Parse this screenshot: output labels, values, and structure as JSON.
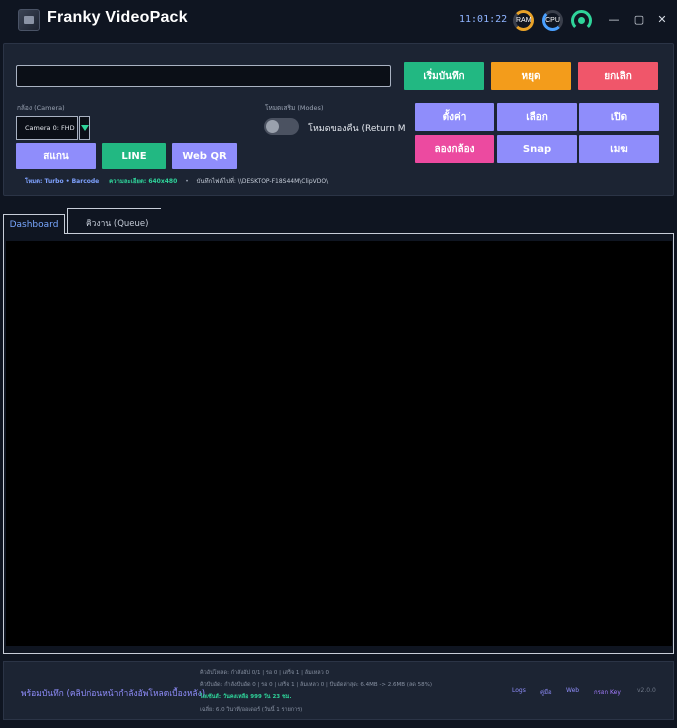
{
  "titlebar": {
    "title": "Franky VideoPack",
    "clock": "11:01:22",
    "ram_label": "RAM",
    "cpu_label": "CPU",
    "minimize": "—",
    "maximize": "▢",
    "close": "✕"
  },
  "controls": {
    "url_value": "",
    "record_label": "เริ่มบันทึก",
    "stop_label": "หยุด",
    "cancel_label": "ยกเลิก",
    "camera_label": "กล้อง (Camera)",
    "camera_value": "Camera 0: FHD",
    "modes_label": "โหมดเสริม (Modes)",
    "return_mode_label": "โหมดของคืน (Return Moc",
    "scan_label": "สแกน",
    "line_label": "LINE",
    "webqr_label": "Web QR",
    "settings_label": "ตั้งค่า",
    "select_label": "เลือก",
    "open_label": "เปิด",
    "testcam_label": "ลองกล้อง",
    "snap_label": "Snap",
    "ms_label": "เมฆ",
    "status_mode": "โหมด: Turbo • Barcode",
    "status_resolution": "ความละเอียด: 640x480",
    "status_separator": "•",
    "status_save": "บันทึกไฟล์ไปที่: \\\\DESKTOP-F18S44M\\ClipVDO\\"
  },
  "tabs": [
    {
      "label": "Dashboard",
      "active": true
    },
    {
      "label": "คิวงาน (Queue)",
      "active": false
    }
  ],
  "footer": {
    "ready": "พร้อมบันทึก (คลิปก่อนหน้ากำลังอัพโหลดเบื้องหลัง)",
    "line1": "คิวอัปโหลด: กำลังอัป 0/1 | รอ 0 | เสร็จ 1 | ล้มเหลว 0",
    "line2": "คิวบีบอัด: กำลังบีบอัด 0 | รอ 0 | เสร็จ 1 | ล้มเหลว 0 | บีบอัดล่าสุด: 6.4MB -> 2.6MB (ลด 58%)",
    "line3": "ไลเซ้นส์: วันคงเหลือ 999 วัน 23 ชม.",
    "line4": "เฉลี่ย: 6.0 วินาที/ออเดอร์ (วันนี้ 1 รายการ)",
    "logs": "Logs",
    "manual": "คู่มือ",
    "web": "Web",
    "key": "กรอก Key",
    "version": "v2.0.0"
  },
  "colors": {
    "green": "#22b882",
    "orange": "#f39c1b",
    "red": "#f0566a",
    "purple": "#8f8dfb",
    "pink": "#ec4aa0"
  }
}
